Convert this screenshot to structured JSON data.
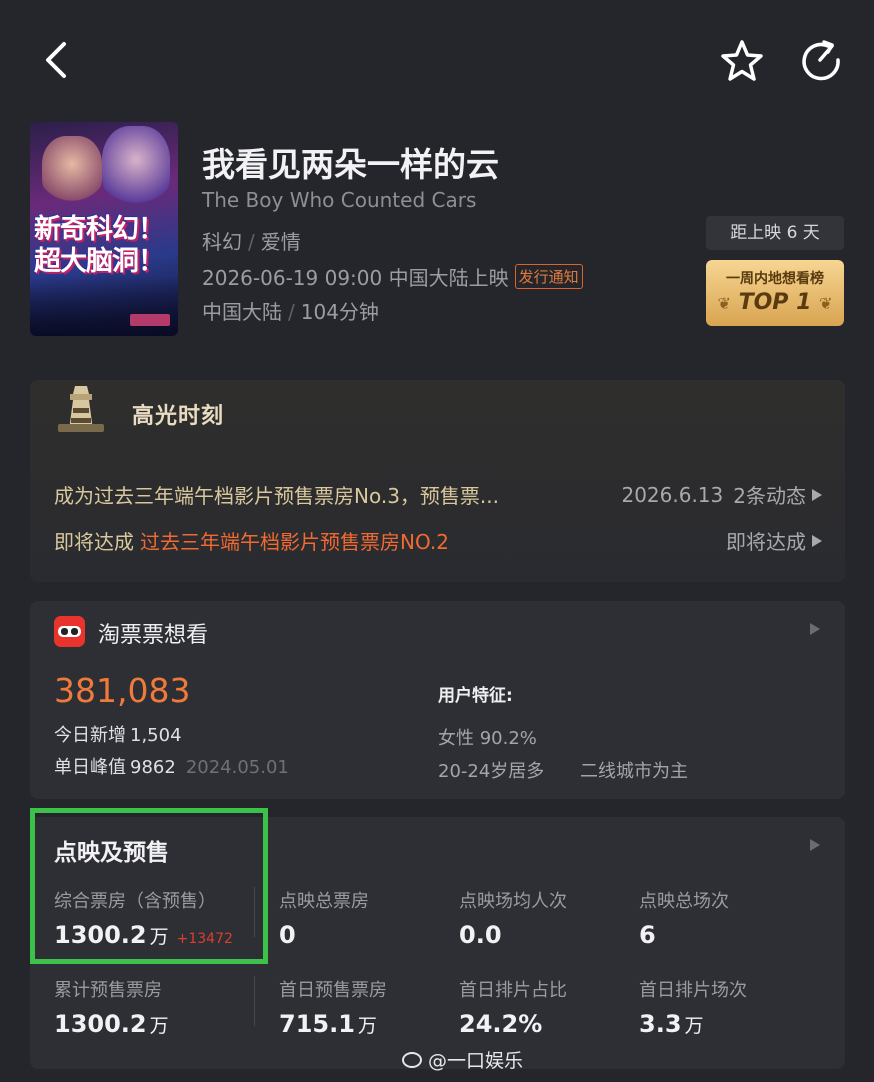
{
  "nav": {
    "back_icon": "chevron-left-icon",
    "favorite_icon": "star-icon",
    "share_icon": "share-icon"
  },
  "movie": {
    "poster_text": "新奇科幻！超大脑洞！",
    "title": "我看见两朵一样的云",
    "english_title": "The Boy Who Counted Cars",
    "genres": [
      "科幻",
      "爱情"
    ],
    "release": "2026-06-19 09:00 中国大陆上映",
    "release_notice": "发行通知",
    "region": "中国大陆",
    "duration": "104分钟",
    "countdown": "距上映 6 天",
    "rank_subtitle": "一周内地想看榜",
    "rank_label": "TOP 1"
  },
  "highlights": {
    "title": "高光时刻",
    "row1_text": "成为过去三年端午档影片预售票房No.3，预售票...",
    "row1_date": "2026.6.13",
    "row1_action": "2条动态",
    "row2_prefix": "即将达成",
    "row2_accent": "过去三年端午档影片预售票房NO.2",
    "row2_action": "即将达成"
  },
  "want_to_see": {
    "title": "淘票票想看",
    "count": "381,083",
    "today_label": "今日新增",
    "today_value": "1,504",
    "peak_label": "单日峰值",
    "peak_value": "9862",
    "peak_date": "2024.05.01",
    "features_label": "用户特征:",
    "feature_gender": "女性 90.2%",
    "feature_age": "20-24岁居多",
    "feature_city": "二线城市为主"
  },
  "presale": {
    "title": "点映及预售",
    "unit": "万",
    "cells": [
      {
        "label": "综合票房（含预售）",
        "value": "1300.2",
        "inc": "+13472"
      },
      {
        "label": "点映总票房",
        "value": "0"
      },
      {
        "label": "点映场均人次",
        "value": "0.0"
      },
      {
        "label": "点映总场次",
        "value": "6"
      },
      {
        "label": "累计预售票房",
        "value": "1300.2"
      },
      {
        "label": "首日预售票房",
        "value": "715.1"
      },
      {
        "label": "首日排片占比",
        "value": "24.2%"
      },
      {
        "label": "首日排片场次",
        "value": "3.3"
      }
    ]
  },
  "watermark": "@一口娱乐",
  "colors": {
    "background": "#25262b",
    "card": "#2e2f35",
    "accent_orange": "#f07a3a",
    "highlight_box": "#3cc24a",
    "rank_gold": "#e8bd6c"
  }
}
